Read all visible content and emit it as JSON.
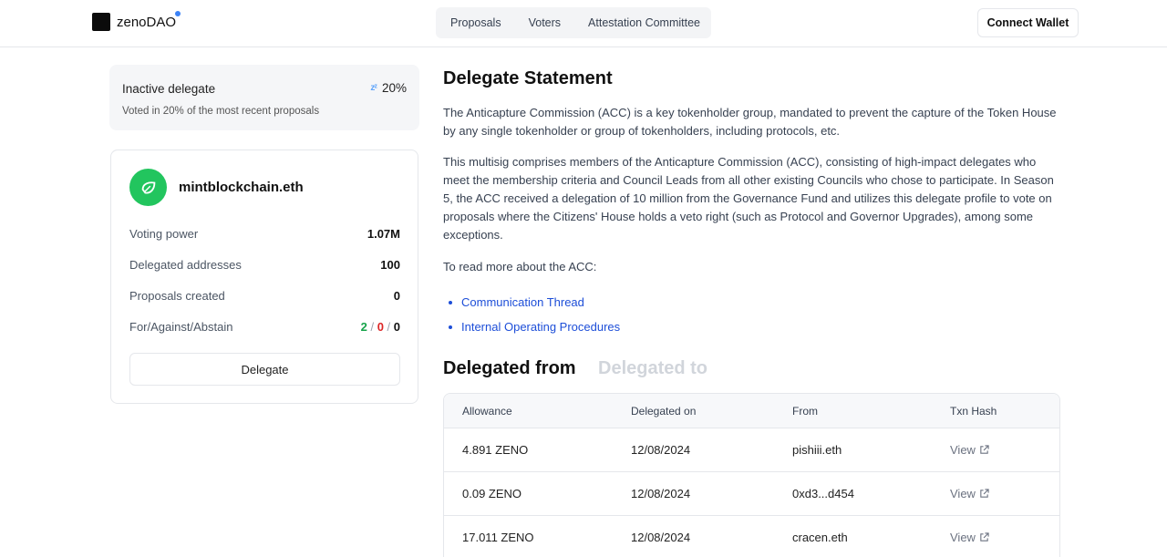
{
  "header": {
    "brand": "zenoDAO",
    "nav": [
      "Proposals",
      "Voters",
      "Attestation Committee"
    ],
    "connect_label": "Connect Wallet"
  },
  "inactive": {
    "title": "Inactive delegate",
    "percent": "20%",
    "subtitle": "Voted in 20% of the most recent proposals"
  },
  "profile": {
    "name": "mintblockchain.eth",
    "stats": [
      {
        "label": "Voting power",
        "value": "1.07M"
      },
      {
        "label": "Delegated addresses",
        "value": "100"
      },
      {
        "label": "Proposals created",
        "value": "0"
      }
    ],
    "votes": {
      "label": "For/Against/Abstain",
      "for": "2",
      "against": "0",
      "abstain": "0"
    },
    "delegate_label": "Delegate"
  },
  "statement": {
    "title": "Delegate Statement",
    "p1": "The Anticapture Commission (ACC) is a key tokenholder group, mandated to prevent the capture of the Token House by any single tokenholder or group of tokenholders, including protocols, etc.",
    "p2": "This multisig comprises members of the Anticapture Commission (ACC), consisting of high-impact delegates who meet the membership criteria and Council Leads from all other existing Councils who chose to participate. In Season 5, the ACC received a delegation of 10 million from the Governance Fund and utilizes this delegate profile to vote on proposals where the Citizens' House holds a veto right (such as Protocol and Governor Upgrades), among some exceptions.",
    "p3": "To read more about the ACC:",
    "links": [
      "Communication Thread",
      "Internal Operating Procedures"
    ]
  },
  "delegations": {
    "tab_from": "Delegated from",
    "tab_to": "Delegated to",
    "columns": [
      "Allowance",
      "Delegated on",
      "From",
      "Txn Hash"
    ],
    "rows": [
      {
        "allowance": "4.891 ZENO",
        "date": "12/08/2024",
        "from": "pishiii.eth",
        "txn": "View"
      },
      {
        "allowance": "0.09 ZENO",
        "date": "12/08/2024",
        "from": "0xd3...d454",
        "txn": "View"
      },
      {
        "allowance": "17.011 ZENO",
        "date": "12/08/2024",
        "from": "cracen.eth",
        "txn": "View"
      }
    ]
  },
  "colors": {
    "accent": "#3b82f6",
    "for": "#16a34a",
    "against": "#dc2626",
    "avatar": "#22c55e"
  }
}
